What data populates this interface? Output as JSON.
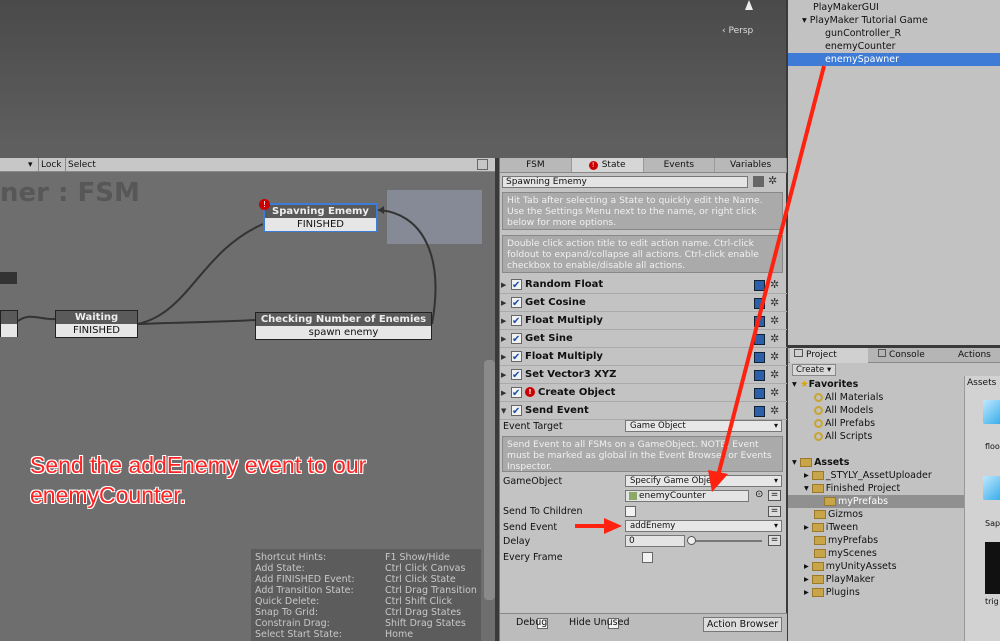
{
  "scene": {
    "persp_label": "Persp"
  },
  "hierarchy": {
    "items": [
      "PlayMakerGUI",
      "PlayMaker Tutorial Game",
      "gunController_R",
      "enemyCounter",
      "enemySpawner"
    ]
  },
  "fsm_toolbar": {
    "lock": "Lock",
    "select": "Select"
  },
  "canvas": {
    "title": "ner : FSM",
    "states": [
      {
        "name": "Spavning Ememy",
        "event": "FINISHED",
        "error": "!"
      },
      {
        "name": "Waiting",
        "event": "FINISHED"
      },
      {
        "name": "Checking Number of Enemies",
        "event": "spawn enemy"
      }
    ],
    "annotation_line1": "Send the addEnemy event to our",
    "annotation_line2": "enemyCounter.",
    "hints": [
      [
        "Shortcut Hints:",
        "F1 Show/Hide"
      ],
      [
        "Add State:",
        "Ctrl Click Canvas"
      ],
      [
        "Add FINISHED Event:",
        "Ctrl Click State"
      ],
      [
        "Add Transition State:",
        "Ctrl Drag Transition"
      ],
      [
        "Quick Delete:",
        "Ctrl Shift Click"
      ],
      [
        "Snap To Grid:",
        "Ctrl Drag States"
      ],
      [
        "Constrain Drag:",
        "Shift Drag States"
      ],
      [
        "Select Start State:",
        "Home"
      ]
    ]
  },
  "inspector": {
    "tabs": [
      "FSM",
      "State",
      "Events",
      "Variables"
    ],
    "state_name": "Spawning Ememy",
    "hint1": "Hit Tab after selecting a State to quickly edit the Name. Use the Settings Menu next to the name, or right click below for more options.",
    "hint2": "Double click action title to edit action name. Ctrl-click foldout to expand/collapse all actions. Ctrl-click enable checkbox to enable/disable all actions.",
    "actions": [
      "Random Float",
      "Get Cosine",
      "Float Multiply",
      "Get Sine",
      "Float Multiply",
      "Set Vector3 XYZ",
      "Create Object",
      "Send Event"
    ],
    "event_target_label": "Event Target",
    "event_target_value": "Game Object",
    "send_event_note": "Send Event to all FSMs on a GameObject. NOTE: Event must be marked as global in the Event Browser or Events Inspector.",
    "gameobject_label": "GameObject",
    "gameobject_mode": "Specify Game Object",
    "gameobject_value": "enemyCounter",
    "send_to_children_label": "Send To Children",
    "send_event_label": "Send Event",
    "send_event_value": "addEnemy",
    "delay_label": "Delay",
    "delay_value": "0",
    "every_frame_label": "Every Frame",
    "debug_label": "Debug",
    "hide_unused_label": "Hide Unused",
    "action_browser": "Action Browser"
  },
  "project": {
    "tabs": [
      "Project",
      "Console",
      "Actions"
    ],
    "create": "Create",
    "favorites_label": "Favorites",
    "favorites": [
      "All Materials",
      "All Models",
      "All Prefabs",
      "All Scripts"
    ],
    "assets_label": "Assets",
    "folders": [
      "_STYLY_AssetUploader",
      "Finished Project",
      "myPrefabs",
      "Gizmos",
      "iTween",
      "myPrefabs",
      "myScenes",
      "myUnityAssets",
      "PlayMaker",
      "Plugins"
    ],
    "assets_header": "Assets",
    "asset_items": [
      "floo",
      "Sap",
      "trig"
    ]
  }
}
